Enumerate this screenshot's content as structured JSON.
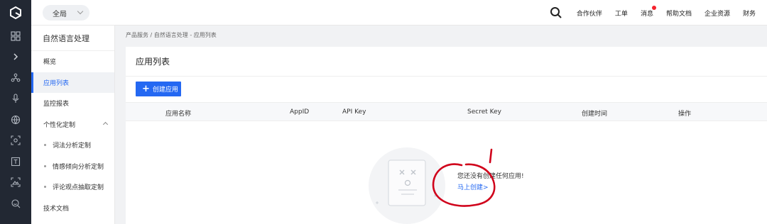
{
  "topbar": {
    "region": "全局",
    "nav": [
      {
        "label": "合作伙伴"
      },
      {
        "label": "工单"
      },
      {
        "label": "消息",
        "badge": true
      },
      {
        "label": "帮助文档"
      },
      {
        "label": "企业资源"
      },
      {
        "label": "财务"
      }
    ]
  },
  "icon_sidebar": [
    "grid-icon",
    "chevron-right-icon",
    "nodes-icon",
    "microphone-icon",
    "globe-icon",
    "scan-icon",
    "text-icon",
    "image-icon",
    "face-scan-icon"
  ],
  "sidenav": {
    "title": "自然语言处理",
    "items": [
      {
        "label": "概览"
      },
      {
        "label": "应用列表"
      },
      {
        "label": "监控报表"
      },
      {
        "label": "个性化定制"
      },
      {
        "label": "词法分析定制"
      },
      {
        "label": "情感倾向分析定制"
      },
      {
        "label": "评论观点抽取定制"
      },
      {
        "label": "技术文档"
      }
    ]
  },
  "breadcrumb": "产品服务 / 自然语言处理 - 应用列表",
  "main": {
    "title": "应用列表",
    "create_button": "创建应用",
    "columns": [
      "应用名称",
      "AppID",
      "API Key",
      "Secret Key",
      "创建时间",
      "操作"
    ],
    "empty_message": "您还没有创建任何应用!",
    "empty_link": "马上创建>"
  },
  "colors": {
    "accent": "#2468f2",
    "sidebar_dark": "#222833",
    "badge": "#f5222d",
    "annotation": "#d0021b"
  }
}
